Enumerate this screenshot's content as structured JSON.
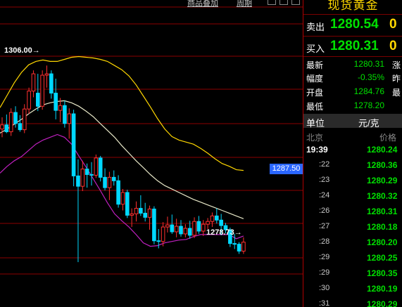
{
  "toolbar": {
    "product_label": "商品叠加",
    "period_label": "周期"
  },
  "chart": {
    "current_price_tag": "1287.50",
    "high_annotation": "1306.00",
    "low_annotation": "1278.73",
    "colors": {
      "up": "#ff3030",
      "down": "#00d8ff",
      "upper_band": "#ffd700",
      "mid_band": "#e8e8c8",
      "lower_band": "#c020c0",
      "grid": "#8b0000"
    }
  },
  "chart_data": {
    "type": "candlestick",
    "ohlc": [
      [
        1296.8,
        1298.5,
        1295.6,
        1297.4
      ],
      [
        1297.4,
        1298.9,
        1296.2,
        1296.4
      ],
      [
        1296.4,
        1299.8,
        1295.8,
        1299.2
      ],
      [
        1299.2,
        1300.1,
        1297.0,
        1297.6
      ],
      [
        1297.6,
        1298.8,
        1296.4,
        1296.7
      ],
      [
        1296.7,
        1300.4,
        1296.2,
        1299.7
      ],
      [
        1299.7,
        1302.8,
        1299.0,
        1302.3
      ],
      [
        1302.3,
        1305.3,
        1301.4,
        1304.8
      ],
      [
        1302.0,
        1304.8,
        1299.4,
        1300.1
      ],
      [
        1300.1,
        1305.3,
        1299.6,
        1304.6
      ],
      [
        1304.6,
        1306.0,
        1302.8,
        1304.8
      ],
      [
        1304.8,
        1305.3,
        1301.2,
        1302.0
      ],
      [
        1302.0,
        1304.1,
        1298.2,
        1299.5
      ],
      [
        1299.5,
        1301.3,
        1297.8,
        1300.2
      ],
      [
        1300.2,
        1300.9,
        1297.0,
        1297.6
      ],
      [
        1297.6,
        1299.8,
        1295.4,
        1299.0
      ],
      [
        1299.0,
        1299.6,
        1288.5,
        1290.0
      ],
      [
        1290.0,
        1292.4,
        1277.5,
        1288.5
      ],
      [
        1288.5,
        1292.2,
        1287.8,
        1291.0
      ],
      [
        1291.0,
        1291.8,
        1288.3,
        1290.2
      ],
      [
        1290.2,
        1292.0,
        1288.6,
        1290.1
      ],
      [
        1290.1,
        1293.1,
        1289.7,
        1292.6
      ],
      [
        1292.6,
        1292.9,
        1289.2,
        1289.8
      ],
      [
        1289.8,
        1291.1,
        1287.9,
        1288.3
      ],
      [
        1288.3,
        1290.6,
        1286.5,
        1289.8
      ],
      [
        1289.8,
        1290.8,
        1288.6,
        1289.3
      ],
      [
        1289.3,
        1290.1,
        1285.4,
        1285.9
      ],
      [
        1285.9,
        1288.1,
        1285.0,
        1287.6
      ],
      [
        1287.6,
        1288.0,
        1283.9,
        1284.3
      ],
      [
        1284.3,
        1285.3,
        1282.6,
        1284.5
      ],
      [
        1284.5,
        1286.3,
        1283.4,
        1285.3
      ],
      [
        1285.3,
        1287.2,
        1284.2,
        1284.6
      ],
      [
        1284.6,
        1286.1,
        1283.4,
        1284.0
      ],
      [
        1284.0,
        1285.7,
        1282.2,
        1285.2
      ],
      [
        1285.2,
        1285.6,
        1280.1,
        1280.6
      ],
      [
        1280.6,
        1282.3,
        1279.5,
        1280.5
      ],
      [
        1280.5,
        1283.3,
        1279.8,
        1282.6
      ],
      [
        1282.6,
        1284.1,
        1281.8,
        1282.9
      ],
      [
        1282.9,
        1284.4,
        1281.6,
        1281.9
      ],
      [
        1281.9,
        1283.8,
        1281.1,
        1282.7
      ],
      [
        1282.7,
        1283.6,
        1281.2,
        1281.6
      ],
      [
        1281.6,
        1283.0,
        1281.1,
        1282.4
      ],
      [
        1282.4,
        1283.5,
        1280.9,
        1281.4
      ],
      [
        1281.4,
        1284.0,
        1281.0,
        1283.4
      ],
      [
        1283.4,
        1284.2,
        1281.6,
        1282.0
      ],
      [
        1282.0,
        1283.6,
        1281.3,
        1283.0
      ],
      [
        1283.0,
        1283.9,
        1282.3,
        1283.4
      ],
      [
        1283.4,
        1284.7,
        1282.6,
        1284.2
      ],
      [
        1284.2,
        1285.3,
        1283.1,
        1283.6
      ],
      [
        1283.6,
        1284.5,
        1281.4,
        1282.8
      ],
      [
        1282.8,
        1283.2,
        1281.7,
        1282.2
      ],
      [
        1282.2,
        1282.5,
        1279.7,
        1280.2
      ],
      [
        1280.2,
        1281.6,
        1279.4,
        1280.1
      ],
      [
        1280.1,
        1280.4,
        1278.7,
        1279.1
      ],
      [
        1279.1,
        1281.1,
        1278.7,
        1280.4
      ]
    ],
    "upper_band": [
      1299.9,
      1301.7,
      1303.5,
      1305.0,
      1306.1,
      1306.6,
      1306.8,
      1306.6,
      1306.6,
      1306.9,
      1307.2,
      1307.3,
      1307.2,
      1307.1,
      1306.9,
      1306.6,
      1306.0,
      1305.4,
      1304.5,
      1303.2,
      1301.6,
      1300.0,
      1298.3,
      1296.8,
      1295.7,
      1295.2,
      1294.9,
      1294.6,
      1294.0,
      1293.3,
      1292.5,
      1291.8,
      1291.4,
      1290.9,
      1290.8
    ],
    "mid_band": [
      1296.2,
      1296.8,
      1297.5,
      1298.2,
      1299.0,
      1299.7,
      1300.3,
      1300.6,
      1300.8,
      1300.9,
      1300.6,
      1300.1,
      1299.4,
      1298.6,
      1297.6,
      1296.6,
      1295.6,
      1294.4,
      1293.3,
      1292.2,
      1291.2,
      1290.2,
      1289.3,
      1288.6,
      1288.1,
      1287.6,
      1287.1,
      1286.6,
      1286.2,
      1285.8,
      1285.4,
      1285.0,
      1284.6,
      1284.2,
      1283.8
    ],
    "lower_band": [
      1290.4,
      1291.4,
      1292.2,
      1292.8,
      1293.7,
      1294.6,
      1295.2,
      1295.6,
      1296.0,
      1295.6,
      1294.6,
      1292.9,
      1291.3,
      1289.6,
      1287.9,
      1286.1,
      1284.5,
      1283.5,
      1282.6,
      1281.5,
      1280.3,
      1279.8,
      1279.9,
      1280.3,
      1280.5,
      1280.7,
      1280.8,
      1281.2,
      1281.5,
      1281.5,
      1281.5,
      1281.5,
      1281.5,
      1280.9,
      1281.3
    ],
    "ylim": [
      1271.0,
      1315.5
    ]
  },
  "panel": {
    "title": "现货黄金",
    "sell_label": "卖出",
    "sell_price": "1280.54",
    "sell_volume": "0",
    "buy_label": "买入",
    "buy_price": "1280.31",
    "buy_volume": "0",
    "stats": [
      {
        "label": "最新",
        "value": "1280.31",
        "extra": "涨",
        "color": "#00e000"
      },
      {
        "label": "幅度",
        "value": "-0.35%",
        "extra": "昨",
        "color": "#00e000"
      },
      {
        "label": "开盘",
        "value": "1284.76",
        "extra": "最",
        "color": "#00e000"
      },
      {
        "label": "最低",
        "value": "1278.20",
        "extra": "",
        "color": "#00e000"
      }
    ],
    "unit_label": "单位",
    "unit_value": "元/克",
    "list_header_left": "北京",
    "list_header_right": "价格",
    "ticks": [
      {
        "time": "19:39",
        "price": "1280.24"
      },
      {
        "time": ":22",
        "price": "1280.36"
      },
      {
        "time": ":23",
        "price": "1280.29"
      },
      {
        "time": ":24",
        "price": "1280.32"
      },
      {
        "time": ":26",
        "price": "1280.31"
      },
      {
        "time": ":27",
        "price": "1280.18"
      },
      {
        "time": ":28",
        "price": "1280.20"
      },
      {
        "time": ":29",
        "price": "1280.25"
      },
      {
        "time": ":29",
        "price": "1280.35"
      },
      {
        "time": ":30",
        "price": "1280.19"
      },
      {
        "time": ":31",
        "price": "1280.29"
      }
    ]
  }
}
